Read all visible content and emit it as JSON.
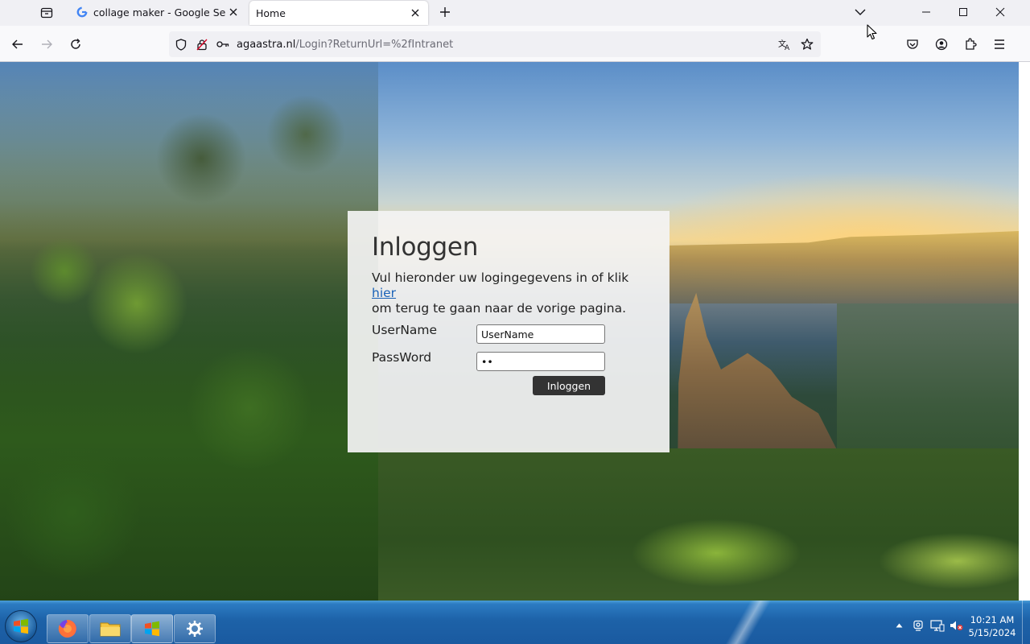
{
  "browser": {
    "tabs": [
      {
        "title": "collage maker - Google Search",
        "active": false
      },
      {
        "title": "Home",
        "active": true
      }
    ],
    "url": {
      "host": "agaastra.nl",
      "path": "/Login?ReturnUrl=%2fIntranet"
    }
  },
  "login": {
    "title": "Inloggen",
    "description_before_link": "Vul hieronder uw logingegevens in of klik ",
    "link_text": "hier",
    "description_after_link": "om terug te gaan naar de vorige pagina.",
    "username_label": "UserName",
    "username_value": "UserName",
    "password_label": "PassWord",
    "password_value": "ab",
    "button_label": "Inloggen"
  },
  "taskbar": {
    "pinned": [
      "firefox-icon",
      "file-explorer-icon",
      "windows-logo-icon",
      "settings-gear-icon"
    ],
    "clock_time": "10:21 AM",
    "clock_date": "5/15/2024"
  },
  "colors": {
    "link": "#1a62b8",
    "button_bg": "#333333",
    "taskbar": "#1d62a8"
  }
}
